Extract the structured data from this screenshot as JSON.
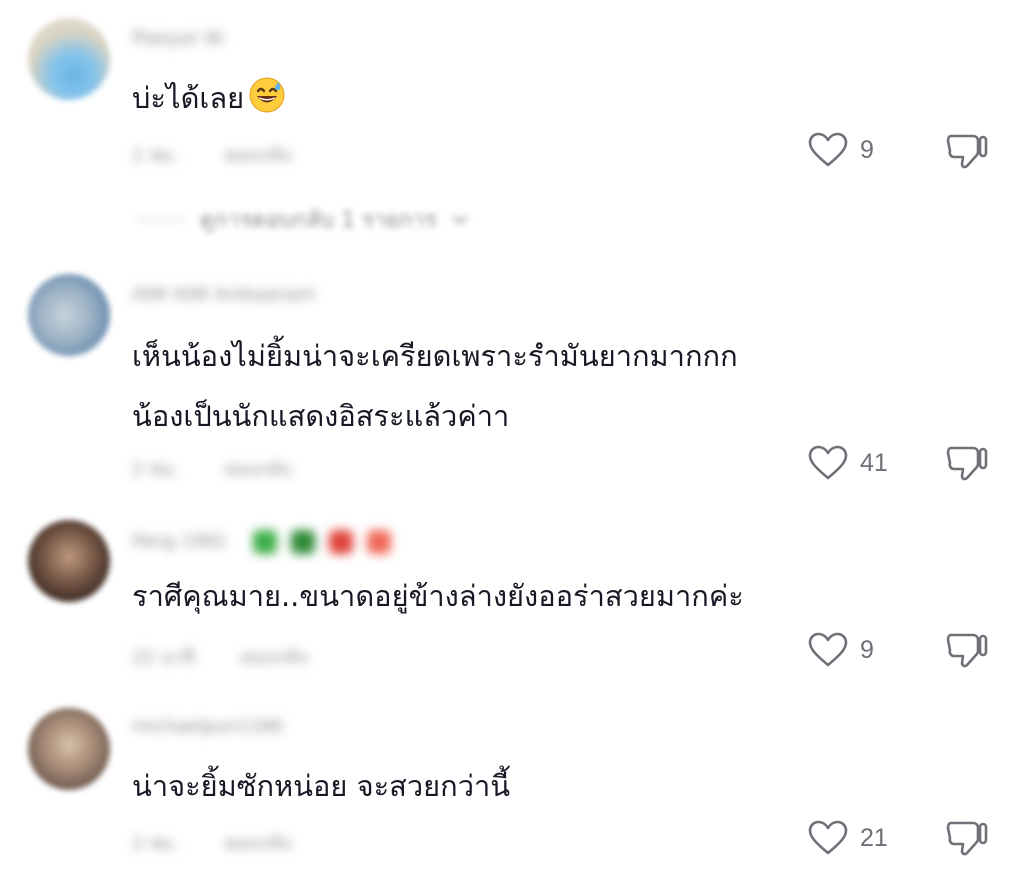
{
  "comments": [
    {
      "username": "Pleeyar W.",
      "text": "บ่ะได้เลย",
      "emoji": "grinning-sweat-emoji",
      "time": "1 ชม.",
      "reply": "ตอบกลับ",
      "likes": "9",
      "view_replies": "ดูการตอบกลับ 1 รายการ"
    },
    {
      "username": "AIW AIW Anikaanam",
      "text_lines": [
        "เห็นน้องไม่ยิ้มน่าจะเครียดเพราะรำมันยากมากกก",
        "น้องเป็นนักแสดงอิสระแล้วค่าา"
      ],
      "time": "2 ชม.",
      "reply": "ตอบกลับ",
      "likes": "41"
    },
    {
      "username": "Pang 1991",
      "text": "ราศีคุณมาย..ขนาดอยู่ข้างล่างยังออร่าสวยมากค่ะ",
      "time": "22 นาที",
      "reply": "ตอบกลับ",
      "likes": "9"
    },
    {
      "username": "michaelpun1166",
      "text": "น่าจะยิ้มซักหน่อย จะสวยกว่านี้",
      "time": "2 ชม.",
      "reply": "ตอบกลับ",
      "likes": "21"
    }
  ],
  "colors": {
    "text": "#161823",
    "secondary": "#8a8b91",
    "icon": "#6f7078"
  },
  "icons": {
    "like": "heart-outline-icon",
    "dislike": "thumbs-down-icon",
    "expand": "chevron-down-icon"
  }
}
